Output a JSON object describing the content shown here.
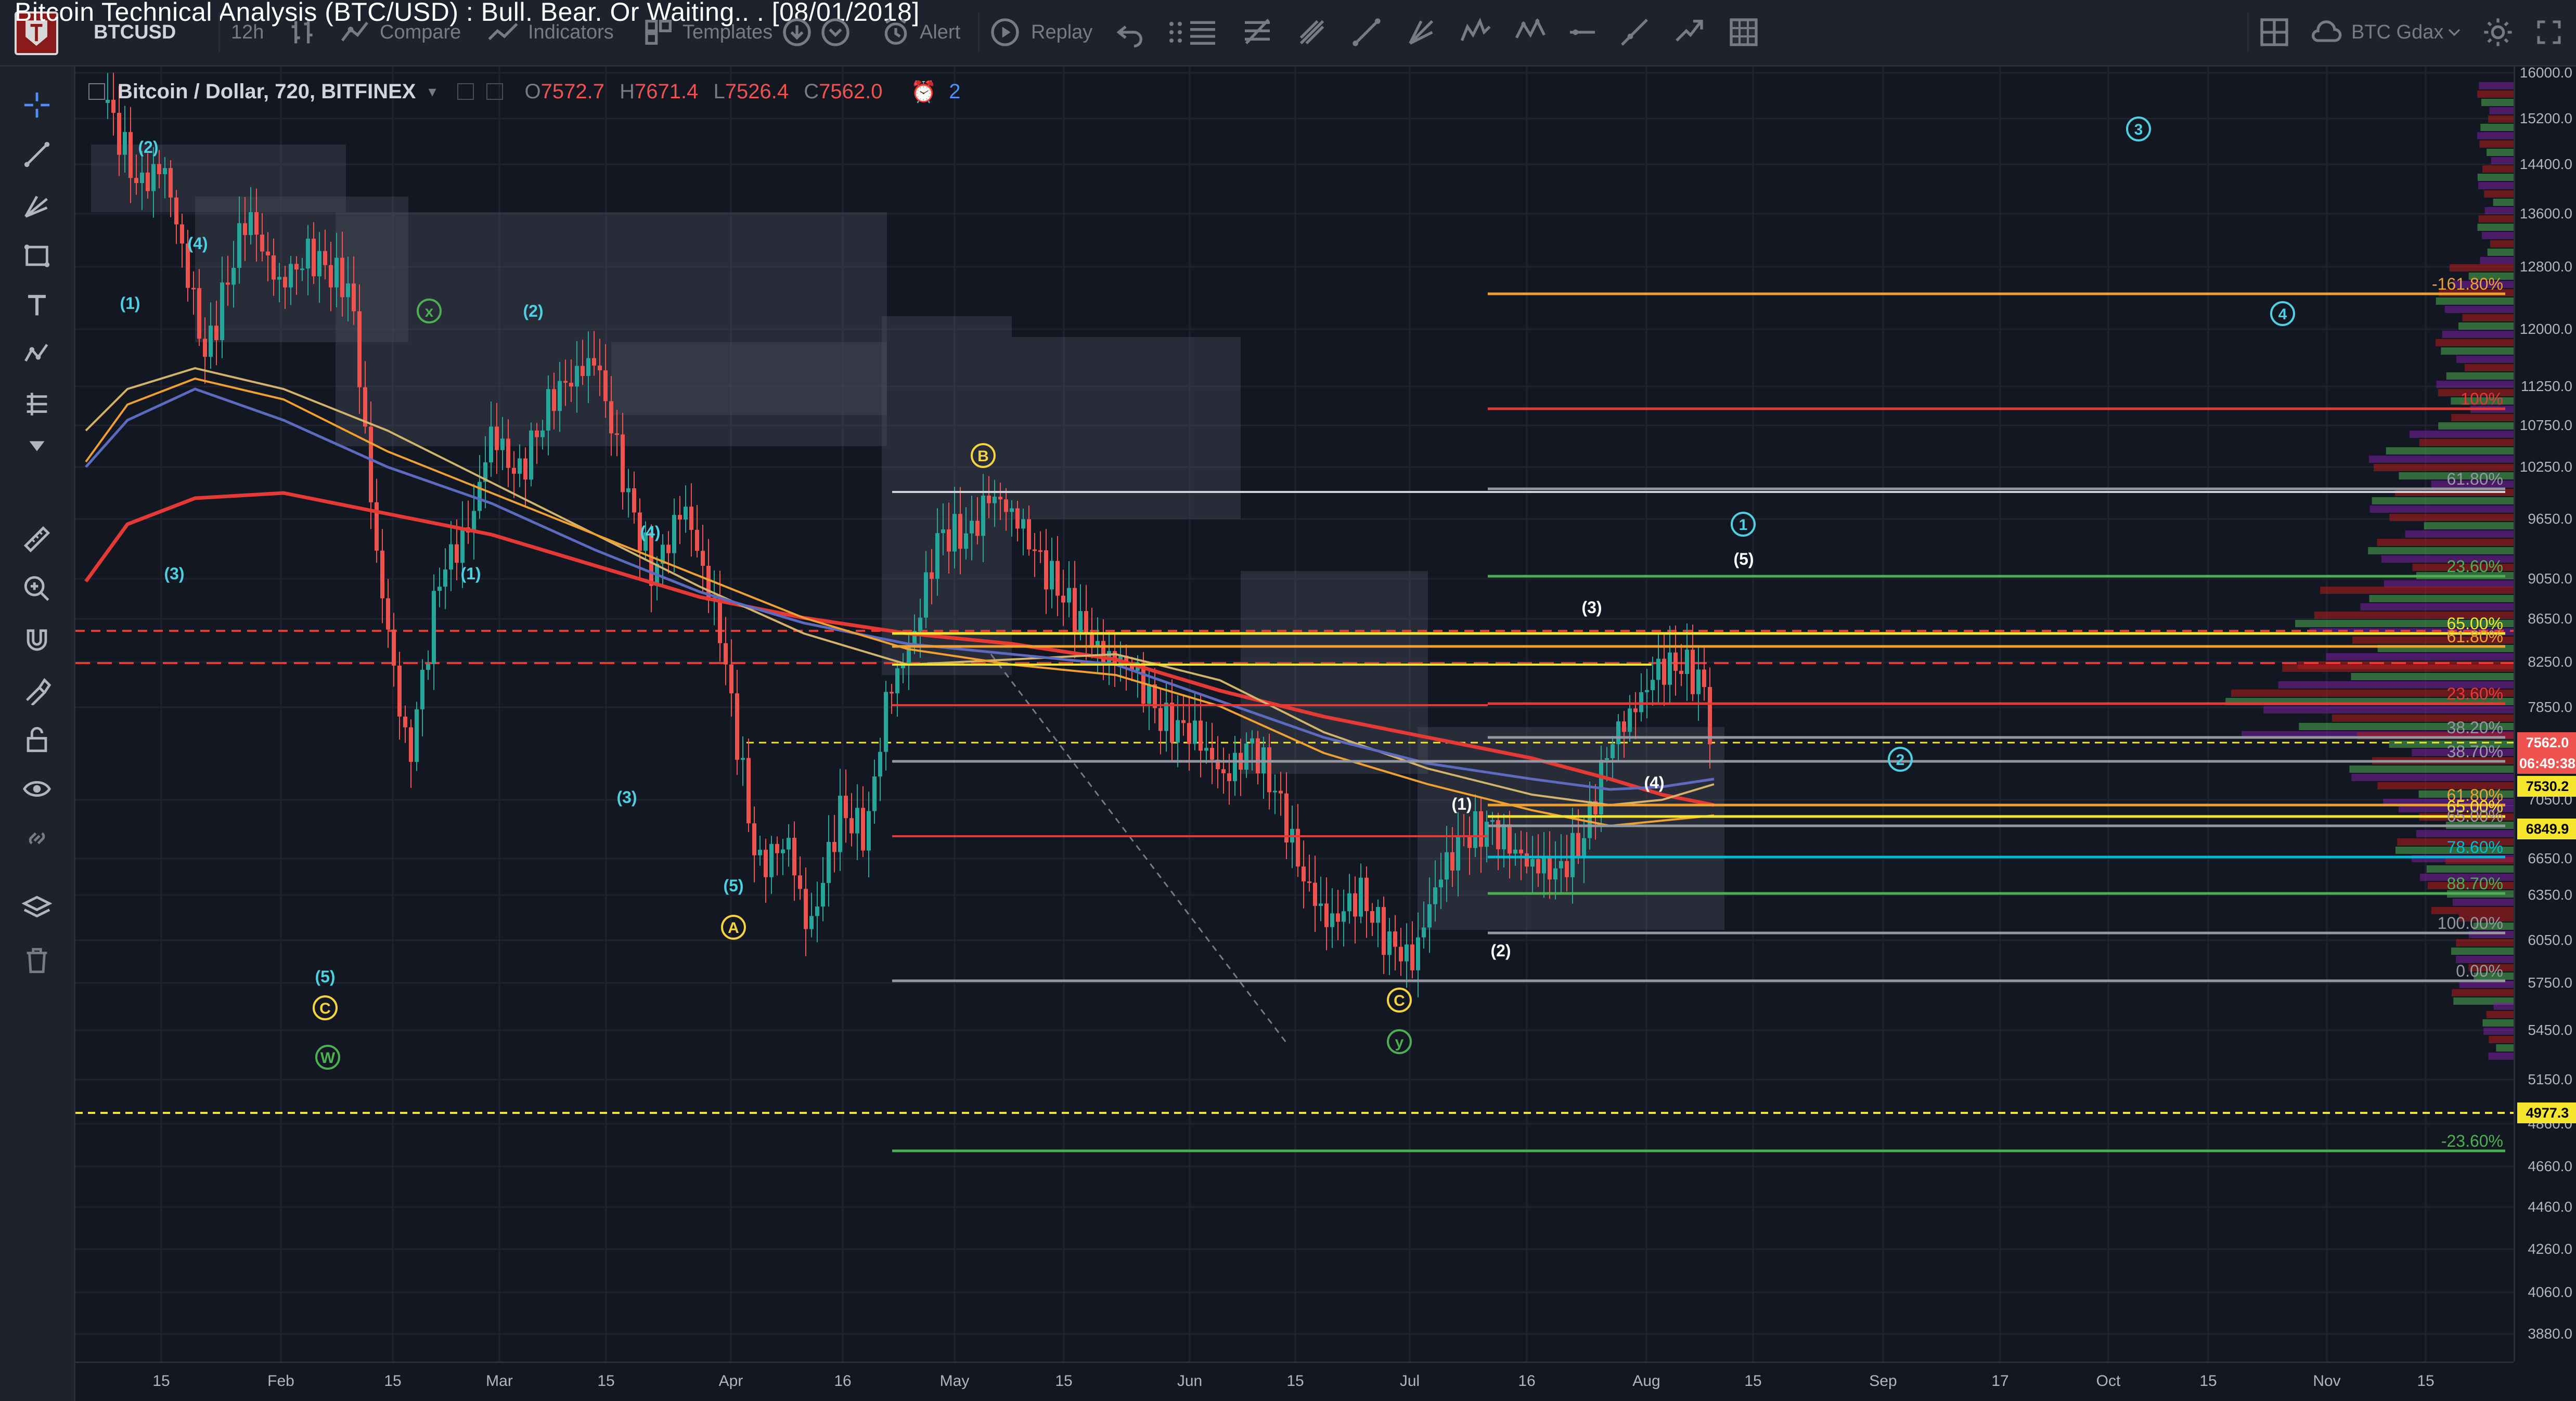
{
  "video_title": "Bitcoin Technical Analysis (BTC/USD) : Bull. Bear. Or Waiting.. . [08/01/2018]",
  "toolbar": {
    "symbol": "BTCUSD",
    "interval": "12h",
    "compare_label": "Compare",
    "indicators_label": "Indicators",
    "templates_label": "Templates",
    "alert_label": "Alert",
    "replay_label": "Replay",
    "feed_label": "BTC Gdax"
  },
  "legend": {
    "title": "Bitcoin / Dollar, 720, BITFINEX",
    "open_label": "O",
    "open": "7572.7",
    "high_label": "H",
    "high": "7671.4",
    "low_label": "L",
    "low": "7526.4",
    "close_label": "C",
    "close": "7562.0",
    "alerts_count": "2"
  },
  "price_axis": {
    "ticks": [
      "16000.0",
      "15200.0",
      "14400.0",
      "13600.0",
      "12800.0",
      "12000.0",
      "11250.0",
      "10750.0",
      "10250.0",
      "9650.0",
      "9050.0",
      "8650.0",
      "8250.0",
      "7850.0",
      "7050.0",
      "6650.0",
      "6350.0",
      "6050.0",
      "5750.0",
      "5450.0",
      "5150.0",
      "4860.0",
      "4660.0",
      "4460.0",
      "4260.0",
      "4060.0",
      "3880.0"
    ],
    "tags": [
      {
        "text": "7562.0",
        "bg": "#ef5350",
        "fg": "#ffffff"
      },
      {
        "text": "06:49:38",
        "bg": "#ef5350",
        "fg": "#ffffff"
      },
      {
        "text": "7530.2",
        "bg": "#f5e52c",
        "fg": "#000000"
      },
      {
        "text": "6849.9",
        "bg": "#f5e52c",
        "fg": "#000000"
      },
      {
        "text": "4977.3",
        "bg": "#f5e52c",
        "fg": "#000000"
      }
    ]
  },
  "time_axis": {
    "ticks": [
      "15",
      "Feb",
      "15",
      "Mar",
      "15",
      "Apr",
      "16",
      "May",
      "15",
      "Jun",
      "15",
      "Jul",
      "16",
      "Aug",
      "15",
      "Sep",
      "17",
      "Oct",
      "15",
      "Nov",
      "15"
    ]
  },
  "fib_labels": [
    "-161.80%",
    "100%",
    "61.80%",
    "23.60%",
    "65.00%",
    "61.80%",
    "23.60%",
    "38.20%",
    "38.70%",
    "61.80%",
    "65.00%",
    "65.00%",
    "78.60%",
    "88.70%",
    "100.00%",
    "0.00%",
    "-23.60%"
  ],
  "wave_labels": [
    {
      "text": "(2)",
      "color": "#4dd0e1",
      "circle": false
    },
    {
      "text": "(4)",
      "color": "#4dd0e1",
      "circle": false
    },
    {
      "text": "(1)",
      "color": "#4dd0e1",
      "circle": false
    },
    {
      "text": "(3)",
      "color": "#4dd0e1",
      "circle": false
    },
    {
      "text": "x",
      "color": "#4caf50",
      "circle": true
    },
    {
      "text": "(2)",
      "color": "#4dd0e1",
      "circle": false
    },
    {
      "text": "(1)",
      "color": "#4dd0e1",
      "circle": false
    },
    {
      "text": "(4)",
      "color": "#4dd0e1",
      "circle": false
    },
    {
      "text": "(3)",
      "color": "#4dd0e1",
      "circle": false
    },
    {
      "text": "(5)",
      "color": "#4dd0e1",
      "circle": false
    },
    {
      "text": "C",
      "color": "#f5d33f",
      "circle": true
    },
    {
      "text": "W",
      "color": "#4caf50",
      "circle": true
    },
    {
      "text": "(5)",
      "color": "#4dd0e1",
      "circle": false
    },
    {
      "text": "A",
      "color": "#f5d33f",
      "circle": true
    },
    {
      "text": "B",
      "color": "#f5d33f",
      "circle": true
    },
    {
      "text": "(1)",
      "color": "#ffffff",
      "circle": false
    },
    {
      "text": "(2)",
      "color": "#ffffff",
      "circle": false
    },
    {
      "text": "C",
      "color": "#f5d33f",
      "circle": true
    },
    {
      "text": "y",
      "color": "#4caf50",
      "circle": true
    },
    {
      "text": "(3)",
      "color": "#ffffff",
      "circle": false
    },
    {
      "text": "(4)",
      "color": "#ffffff",
      "circle": false
    },
    {
      "text": "1",
      "color": "#4dd0e1",
      "circle": true
    },
    {
      "text": "(5)",
      "color": "#ffffff",
      "circle": false
    },
    {
      "text": "2",
      "color": "#4dd0e1",
      "circle": true
    },
    {
      "text": "3",
      "color": "#4dd0e1",
      "circle": true
    },
    {
      "text": "4",
      "color": "#4dd0e1",
      "circle": true
    }
  ],
  "colors": {
    "background": "#131722",
    "grid": "#1f2330",
    "candle_up": "#26a69a",
    "candle_down": "#ef5350",
    "ma_red": "#e53935",
    "ma_blue": "#5c6bc0",
    "ma_orange": "#f0a030",
    "ma_khaki": "#d4b26a",
    "fib_orange": "#f0a030",
    "fib_red": "#e53935",
    "fib_gray": "#9598a1",
    "fib_green": "#4caf50",
    "fib_yellow": "#f5e52c",
    "fib_teal": "#00bcd4",
    "volume_profile_purple": "#7b1fa2"
  }
}
